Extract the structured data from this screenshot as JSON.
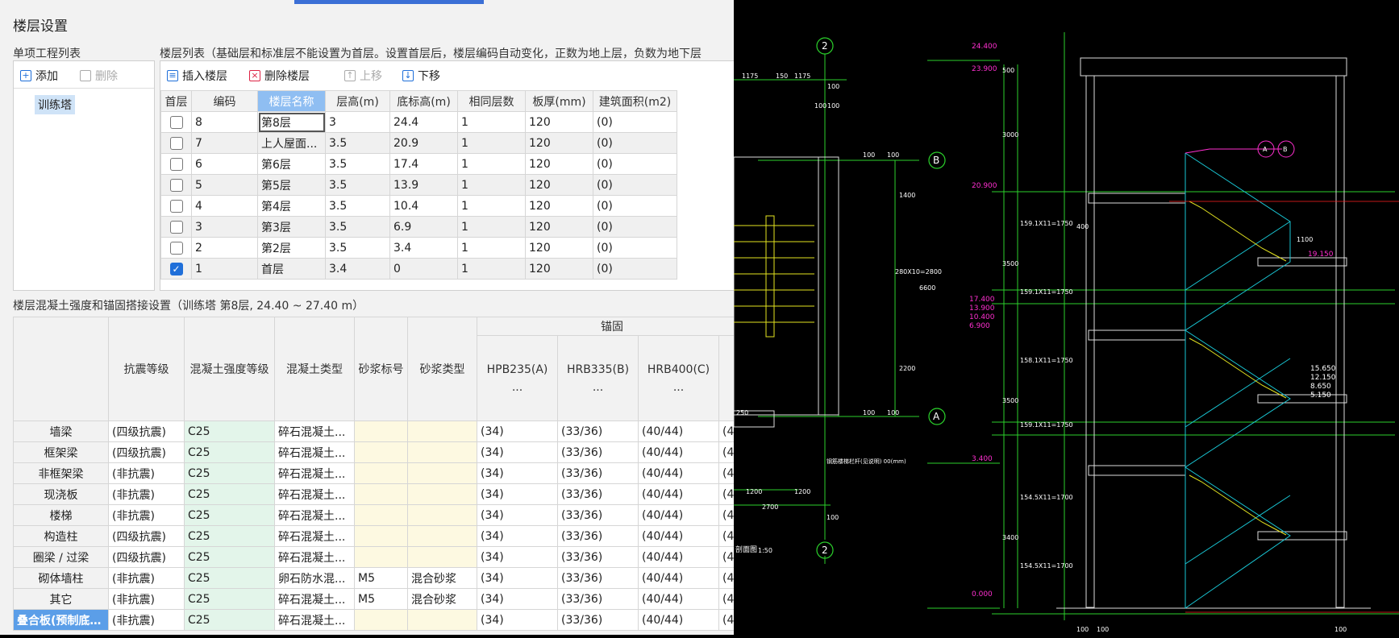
{
  "dialog": {
    "title": "楼层设置",
    "project_list_label": "单项工程列表",
    "add_label": "添加",
    "delete_label": "删除",
    "project_item": "训练塔"
  },
  "floors": {
    "header_note": "楼层列表（基础层和标准层不能设置为首层。设置首层后，楼层编码自动变化，正数为地上层，负数为地下层",
    "toolbar": {
      "insert": "插入楼层",
      "delete": "删除楼层",
      "up": "上移",
      "down": "下移"
    },
    "columns": [
      "首层",
      "编码",
      "楼层名称",
      "层高(m)",
      "底标高(m)",
      "相同层数",
      "板厚(mm)",
      "建筑面积(m2)"
    ],
    "rows": [
      {
        "checked": false,
        "code": "8",
        "name": "第8层",
        "height": "3",
        "elev": "24.4",
        "same": "1",
        "thick": "120",
        "area": "(0)"
      },
      {
        "checked": false,
        "code": "7",
        "name": "上人屋面...",
        "height": "3.5",
        "elev": "20.9",
        "same": "1",
        "thick": "120",
        "area": "(0)"
      },
      {
        "checked": false,
        "code": "6",
        "name": "第6层",
        "height": "3.5",
        "elev": "17.4",
        "same": "1",
        "thick": "120",
        "area": "(0)"
      },
      {
        "checked": false,
        "code": "5",
        "name": "第5层",
        "height": "3.5",
        "elev": "13.9",
        "same": "1",
        "thick": "120",
        "area": "(0)"
      },
      {
        "checked": false,
        "code": "4",
        "name": "第4层",
        "height": "3.5",
        "elev": "10.4",
        "same": "1",
        "thick": "120",
        "area": "(0)"
      },
      {
        "checked": false,
        "code": "3",
        "name": "第3层",
        "height": "3.5",
        "elev": "6.9",
        "same": "1",
        "thick": "120",
        "area": "(0)"
      },
      {
        "checked": false,
        "code": "2",
        "name": "第2层",
        "height": "3.5",
        "elev": "3.4",
        "same": "1",
        "thick": "120",
        "area": "(0)"
      },
      {
        "checked": true,
        "code": "1",
        "name": "首层",
        "height": "3.4",
        "elev": "0",
        "same": "1",
        "thick": "120",
        "area": "(0)"
      }
    ]
  },
  "anchor": {
    "section_label": "楼层混凝土强度和锚固搭接设置（训练塔  第8层, 24.40 ~ 27.40 m）",
    "group_label": "锚固",
    "columns": [
      "抗震等级",
      "混凝土强度等级",
      "混凝土类型",
      "砂浆标号",
      "砂浆类型",
      "HPB235(A)",
      "HRB335(B)",
      "HRB400(C)"
    ],
    "col_ellipsis": "...",
    "rows": [
      {
        "name": "墙梁",
        "seismic": "(四级抗震)",
        "grade": "C25",
        "type": "碎石混凝土...",
        "mortar": "",
        "mtype": "",
        "a": "(34)",
        "b": "(33/36)",
        "c": "(40/44)",
        "d": "(4"
      },
      {
        "name": "框架梁",
        "seismic": "(四级抗震)",
        "grade": "C25",
        "type": "碎石混凝土...",
        "mortar": "",
        "mtype": "",
        "a": "(34)",
        "b": "(33/36)",
        "c": "(40/44)",
        "d": "(4"
      },
      {
        "name": "非框架梁",
        "seismic": "(非抗震)",
        "grade": "C25",
        "type": "碎石混凝土...",
        "mortar": "",
        "mtype": "",
        "a": "(34)",
        "b": "(33/36)",
        "c": "(40/44)",
        "d": "(4"
      },
      {
        "name": "现浇板",
        "seismic": "(非抗震)",
        "grade": "C25",
        "type": "碎石混凝土...",
        "mortar": "",
        "mtype": "",
        "a": "(34)",
        "b": "(33/36)",
        "c": "(40/44)",
        "d": "(4"
      },
      {
        "name": "楼梯",
        "seismic": "(非抗震)",
        "grade": "C25",
        "type": "碎石混凝土...",
        "mortar": "",
        "mtype": "",
        "a": "(34)",
        "b": "(33/36)",
        "c": "(40/44)",
        "d": "(4"
      },
      {
        "name": "构造柱",
        "seismic": "(四级抗震)",
        "grade": "C25",
        "type": "碎石混凝土...",
        "mortar": "",
        "mtype": "",
        "a": "(34)",
        "b": "(33/36)",
        "c": "(40/44)",
        "d": "(4"
      },
      {
        "name": "圈梁 / 过梁",
        "seismic": "(四级抗震)",
        "grade": "C25",
        "type": "碎石混凝土...",
        "mortar": "",
        "mtype": "",
        "a": "(34)",
        "b": "(33/36)",
        "c": "(40/44)",
        "d": "(4"
      },
      {
        "name": "砌体墙柱",
        "seismic": "(非抗震)",
        "grade": "C25",
        "type": "卵石防水混...",
        "mortar": "M5",
        "mtype": "混合砂浆",
        "a": "(34)",
        "b": "(33/36)",
        "c": "(40/44)",
        "d": "(4"
      },
      {
        "name": "其它",
        "seismic": "(非抗震)",
        "grade": "C25",
        "type": "碎石混凝土...",
        "mortar": "M5",
        "mtype": "混合砂浆",
        "a": "(34)",
        "b": "(33/36)",
        "c": "(40/44)",
        "d": "(4"
      },
      {
        "name": "叠合板(预制底板)",
        "seismic": "(非抗震)",
        "grade": "C25",
        "type": "碎石混凝土...",
        "mortar": "",
        "mtype": "",
        "a": "(34)",
        "b": "(33/36)",
        "c": "(40/44)",
        "d": "(4"
      }
    ]
  },
  "cad": {
    "axis_labels": [
      "2",
      "B",
      "A",
      "2",
      "A",
      "B"
    ],
    "dims": [
      "1175",
      "150",
      "1175",
      "100",
      "100",
      "100",
      "100",
      "100",
      "1400",
      "280X10=2800",
      "6600",
      "2200",
      "100",
      "100",
      "1200",
      "1200",
      "2700",
      "100",
      "250",
      "1:50",
      "500",
      "3000",
      "3500",
      "3500",
      "3400",
      "159.1X11=1750",
      "159.1X11=1750",
      "158.1X11=1750",
      "159.1X11=1750",
      "154.5X11=1700",
      "154.5X11=1700",
      "1100",
      "400",
      "100",
      "100",
      "100"
    ],
    "elevations": [
      "24.400",
      "23.900",
      "20.900",
      "19.150",
      "17.400",
      "13.900",
      "10.400",
      "6.900",
      "15.650",
      "12.150",
      "8.650",
      "5.150",
      "3.400",
      "0.000"
    ],
    "notes": [
      "剖面图",
      "钢筋楼梯栏杆(见说明) 00(mm)"
    ]
  }
}
